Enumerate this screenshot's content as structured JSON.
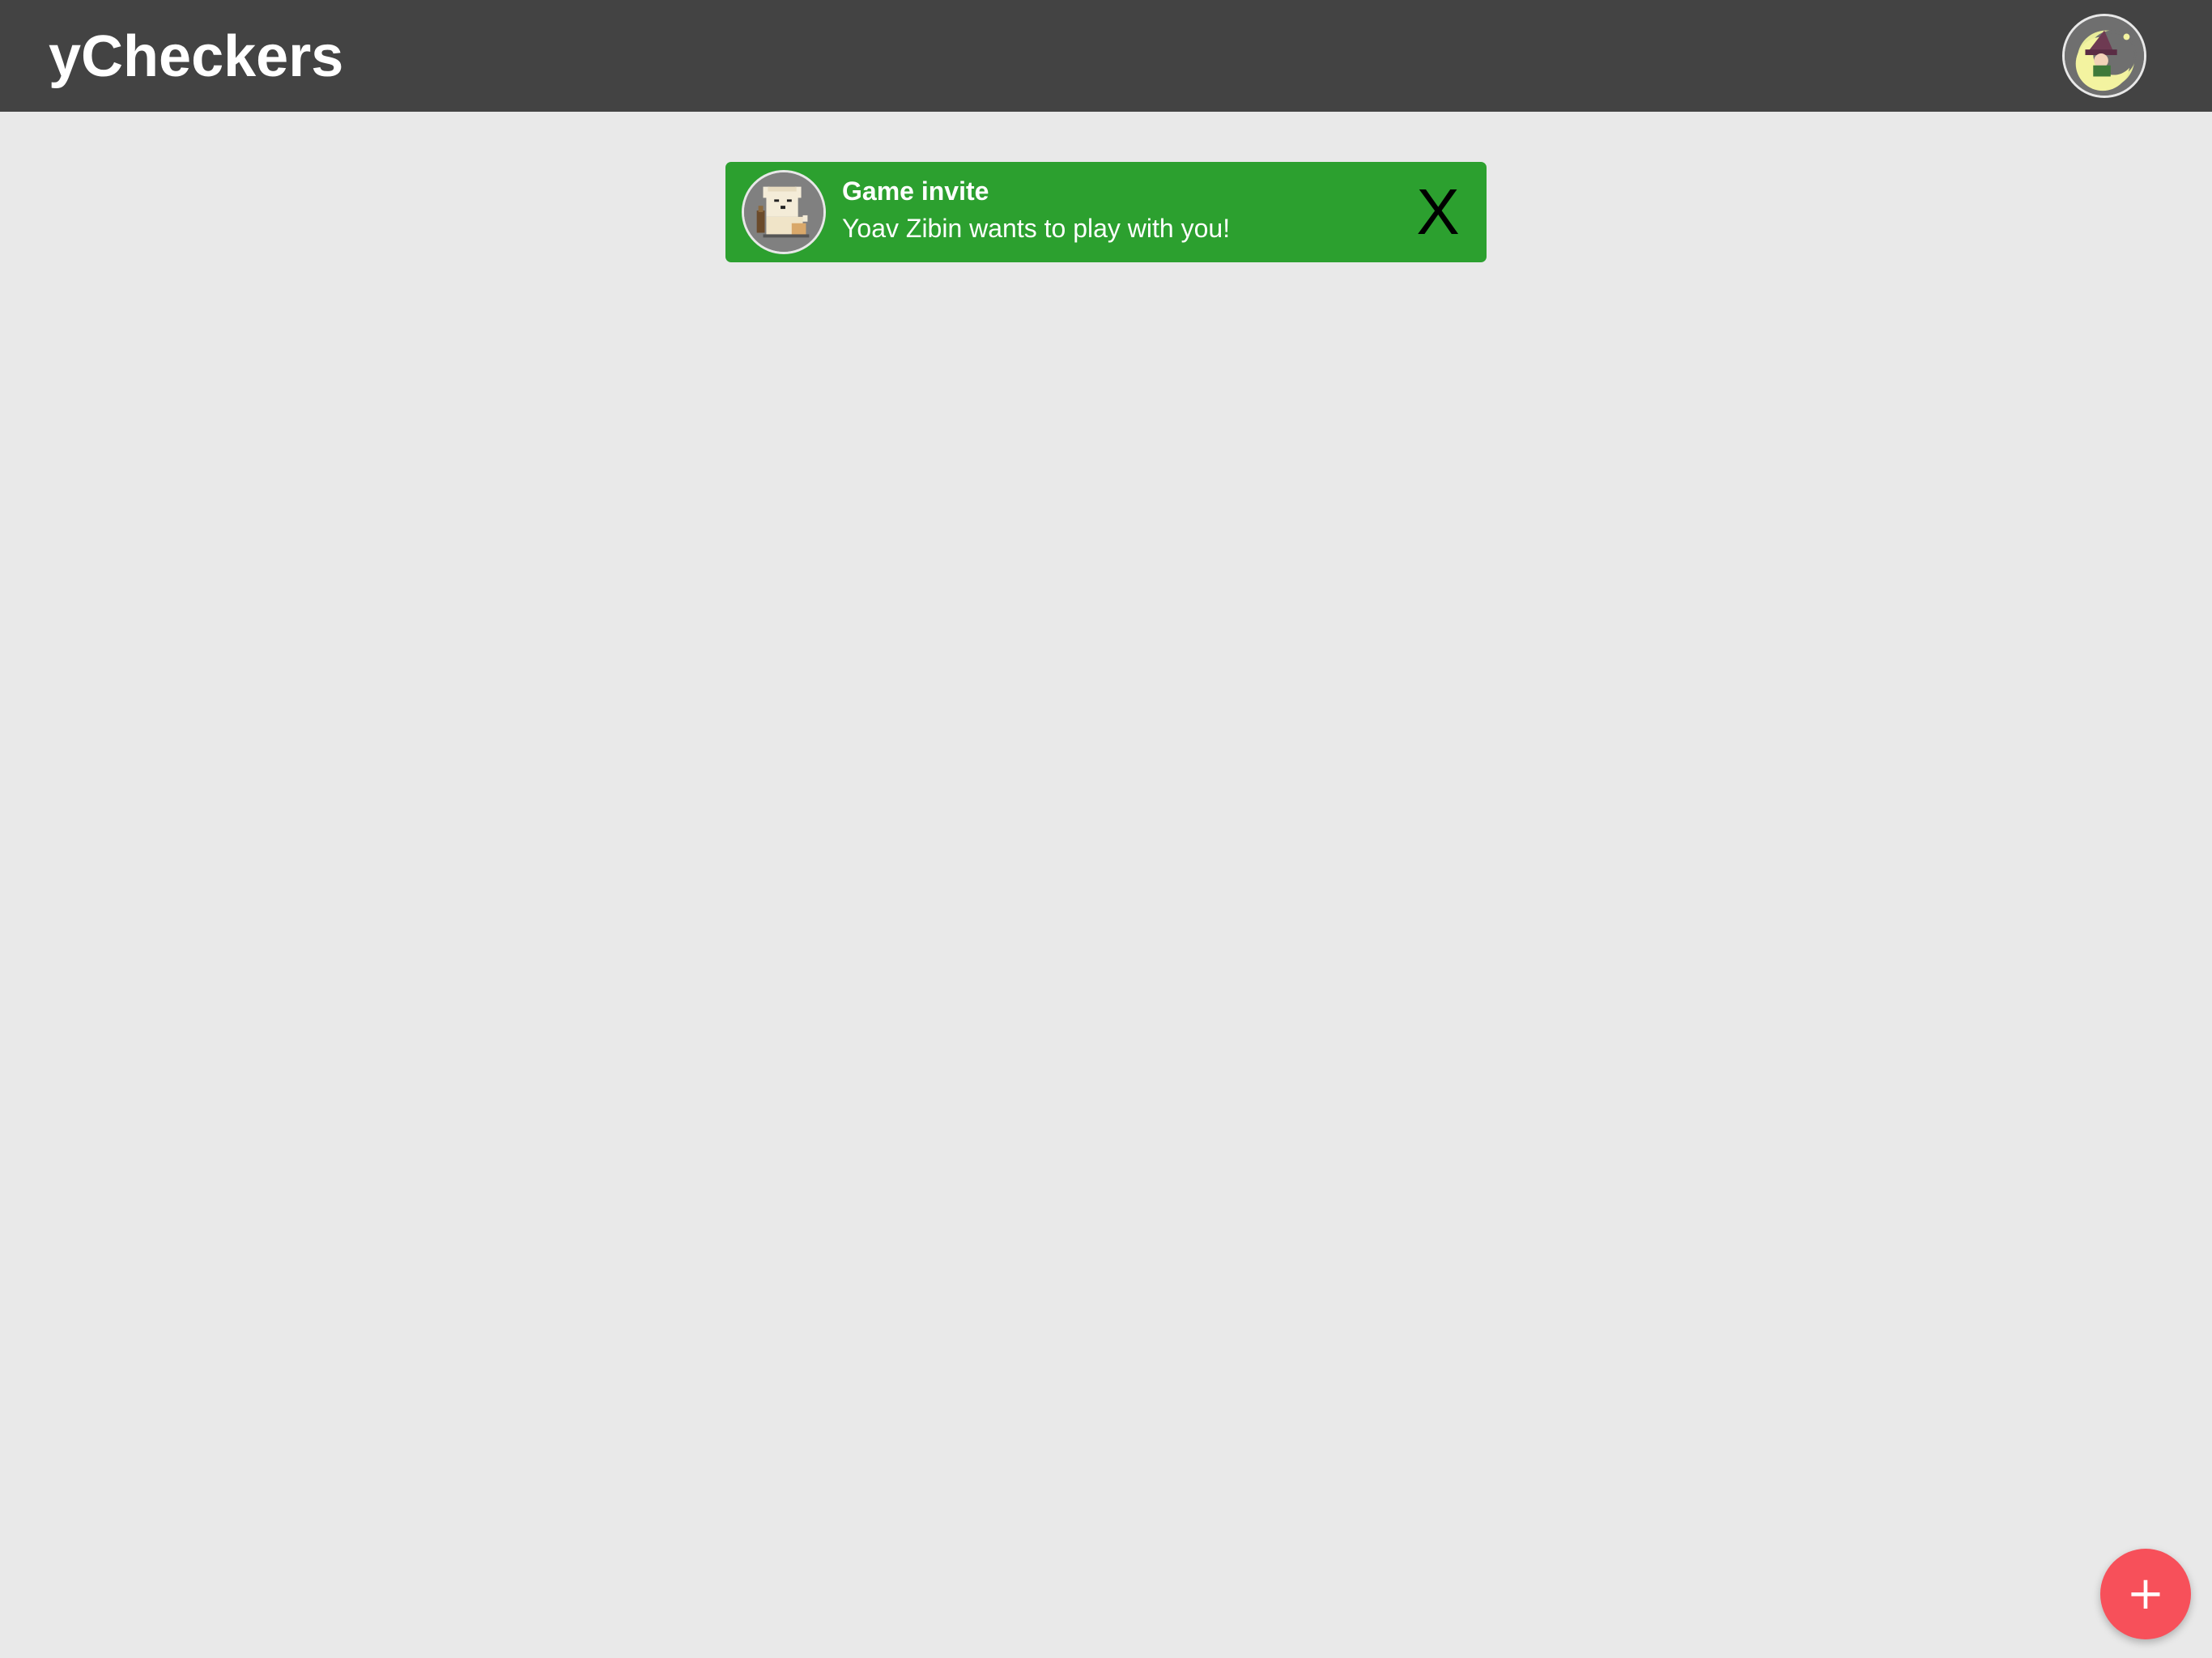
{
  "app": {
    "title": "yCheckers"
  },
  "header": {
    "user_avatar_icon": "user-avatar-witch-on-moon"
  },
  "notification": {
    "title": "Game invite",
    "message": "Yoav Zibin wants to play with you!",
    "close_label": "X",
    "avatar_icon": "sender-avatar-pixel-dog"
  },
  "fab": {
    "icon": "plus-icon",
    "label": "+"
  },
  "colors": {
    "topbar": "#434343",
    "background": "#e9e9e9",
    "notification": "#2ca02f",
    "fab": "#f7505a"
  }
}
